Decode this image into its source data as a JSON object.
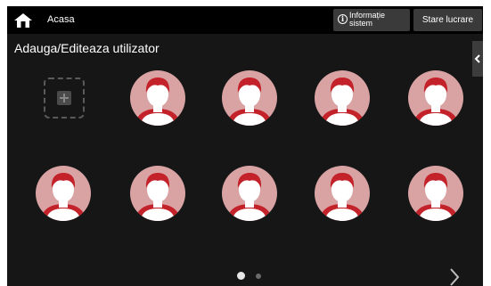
{
  "header": {
    "home_label": "Acasa",
    "info_button": {
      "line1": "Informație",
      "line2": "sistem"
    },
    "status_button": "Stare lucrare"
  },
  "page": {
    "title": "Adauga/Editeaza utilizator"
  },
  "tiles": {
    "add_icon": "add-user-icon",
    "avatar_icon": "user-avatar-icon",
    "avatar_count": 9
  },
  "pagination": {
    "current_page": 1,
    "total_pages": 2
  },
  "colors": {
    "background": "#161616",
    "topbar": "#000000",
    "button": "#3a3a3a",
    "avatar_circle": "#d9a3a3",
    "avatar_hair": "#c4222a",
    "avatar_face": "#ffffff"
  }
}
